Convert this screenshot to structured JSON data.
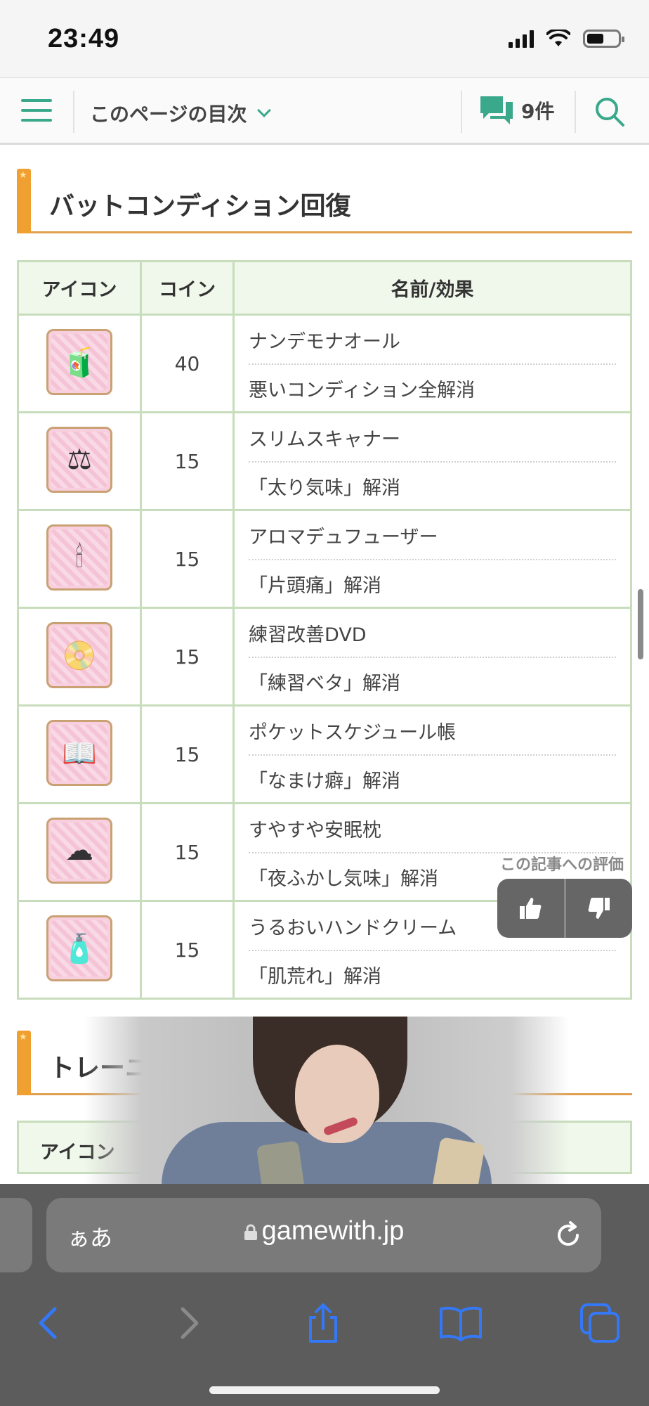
{
  "status_bar": {
    "time": "23:49"
  },
  "header": {
    "toc_label": "このページの目次",
    "comment_count": "9件"
  },
  "section": {
    "title": "バットコンディション回復"
  },
  "table": {
    "headers": {
      "icon": "アイコン",
      "coin": "コイン",
      "effect": "名前/効果"
    },
    "rows": [
      {
        "coin": "40",
        "name": "ナンデモナオール",
        "effect": "悪いコンディション全解消",
        "icon": "drink-bottle-icon"
      },
      {
        "coin": "15",
        "name": "スリムスキャナー",
        "effect": "「太り気味」解消",
        "icon": "scale-icon"
      },
      {
        "coin": "15",
        "name": "アロマデュフューザー",
        "effect": "「片頭痛」解消",
        "icon": "diffuser-icon"
      },
      {
        "coin": "15",
        "name": "練習改善DVD",
        "effect": "「練習ベタ」解消",
        "icon": "dvd-icon"
      },
      {
        "coin": "15",
        "name": "ポケットスケジュール帳",
        "effect": "「なまけ癖」解消",
        "icon": "notebook-icon"
      },
      {
        "coin": "15",
        "name": "すやすや安眠枕",
        "effect": "「夜ふかし気味」解消",
        "icon": "pillow-icon"
      },
      {
        "coin": "15",
        "name": "うるおいハンドクリーム",
        "effect": "「肌荒れ」解消",
        "icon": "hand-cream-icon"
      }
    ]
  },
  "rating": {
    "label": "この記事への評価"
  },
  "next_section": {
    "title": "トレーニ",
    "first_header": "アイコン"
  },
  "browser": {
    "aa_label": "ぁあ",
    "host": "gamewith.jp"
  },
  "colors": {
    "accent_green": "#3aa88a",
    "heading_orange": "#f0a030",
    "table_border": "#c7ddbc",
    "header_bg": "#eff8ea",
    "safari_blue": "#3478f6"
  }
}
